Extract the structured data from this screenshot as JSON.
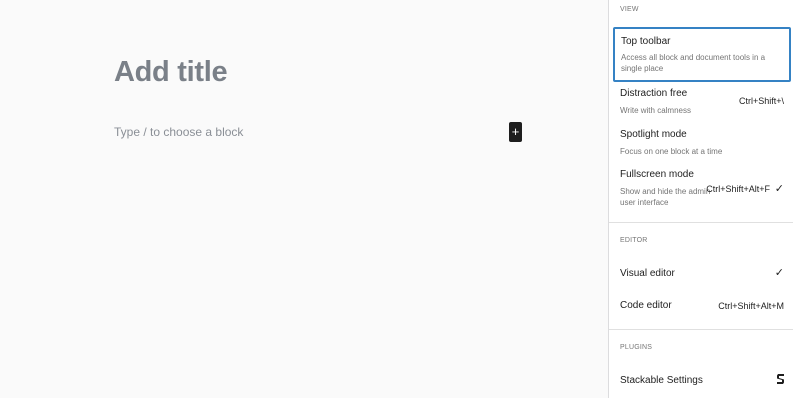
{
  "editor": {
    "title_placeholder": "Add title",
    "block_placeholder": "Type / to choose a block",
    "add_block_icon": "+"
  },
  "menu": {
    "view": {
      "label": "VIEW",
      "items": [
        {
          "label": "Top toolbar",
          "description": "Access all block and document tools in a single place",
          "shortcut": "",
          "checked": false
        },
        {
          "label": "Distraction free",
          "description": "Write with calmness",
          "shortcut": "Ctrl+Shift+\\",
          "checked": false
        },
        {
          "label": "Spotlight mode",
          "description": "Focus on one block at a time",
          "shortcut": "",
          "checked": false
        },
        {
          "label": "Fullscreen mode",
          "description": "Show and hide the admin user interface",
          "shortcut": "Ctrl+Shift+Alt+F",
          "checked": true
        }
      ]
    },
    "editor": {
      "label": "EDITOR",
      "items": [
        {
          "label": "Visual editor",
          "shortcut": "",
          "checked": true
        },
        {
          "label": "Code editor",
          "shortcut": "Ctrl+Shift+Alt+M",
          "checked": false
        }
      ]
    },
    "plugins": {
      "label": "PLUGINS",
      "items": [
        {
          "label": "Stackable Settings",
          "icon": "stackable-logo-icon"
        }
      ]
    },
    "check_glyph": "✓",
    "accent_color": "#3582c4"
  }
}
